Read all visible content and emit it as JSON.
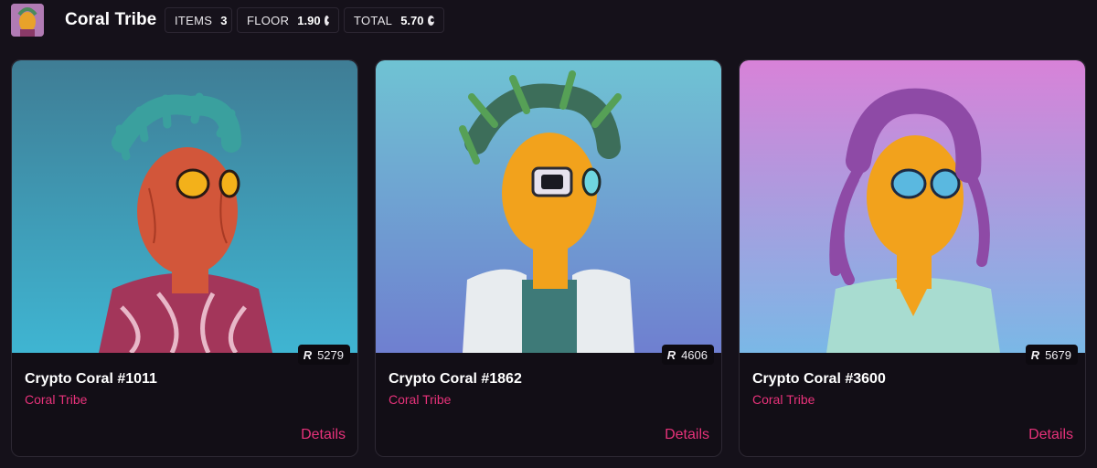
{
  "header": {
    "title": "Coral Tribe",
    "stats": [
      {
        "label": "ITEMS",
        "value": "3",
        "coin": false
      },
      {
        "label": "FLOOR",
        "value": "1.90",
        "coin": true
      },
      {
        "label": "TOTAL",
        "value": "5.70",
        "coin": true
      }
    ]
  },
  "cards": [
    {
      "name": "Crypto Coral #1011",
      "collection": "Coral Tribe",
      "rank_icon": "R",
      "rank": "5279",
      "details_label": "Details",
      "colors": {
        "bg_top": "#3f7d95",
        "bg_bottom": "#3fb5d2",
        "skin": "#d2563a",
        "hair": "#3aa09e",
        "outfit": "#a3365a"
      }
    },
    {
      "name": "Crypto Coral #1862",
      "collection": "Coral Tribe",
      "rank_icon": "R",
      "rank": "4606",
      "details_label": "Details",
      "colors": {
        "bg_top": "#6fc3d3",
        "bg_bottom": "#6f7fd0",
        "skin": "#f2a21c",
        "hair": "#3d6e5a",
        "outfit": "#e8ecef"
      }
    },
    {
      "name": "Crypto Coral #3600",
      "collection": "Coral Tribe",
      "rank_icon": "R",
      "rank": "5679",
      "details_label": "Details",
      "colors": {
        "bg_top": "#d882d8",
        "bg_bottom": "#7ab8e6",
        "skin": "#f2a21c",
        "hair": "#8e4aa6",
        "outfit": "#a8dcd0"
      }
    }
  ]
}
